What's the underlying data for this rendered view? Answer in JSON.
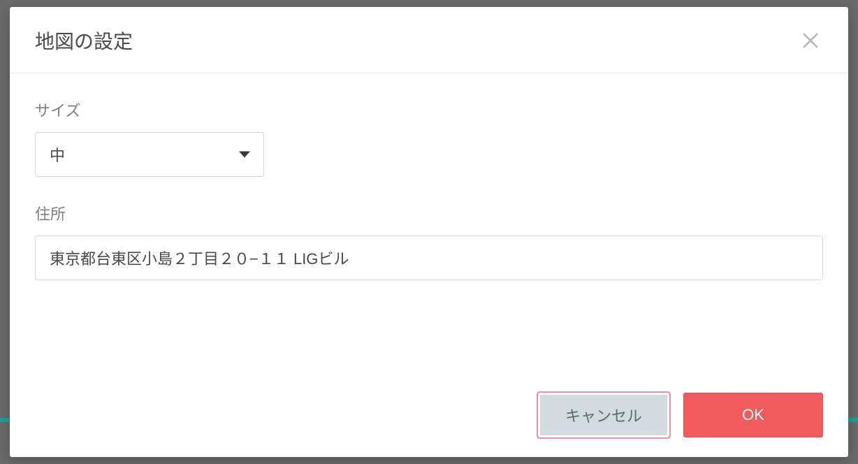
{
  "dialog": {
    "title": "地図の設定",
    "fields": {
      "size": {
        "label": "サイズ",
        "value": "中"
      },
      "address": {
        "label": "住所",
        "value": "東京都台東区小島２丁目２０−１１ LIGビル"
      }
    },
    "buttons": {
      "cancel": "キャンセル",
      "ok": "OK"
    }
  }
}
